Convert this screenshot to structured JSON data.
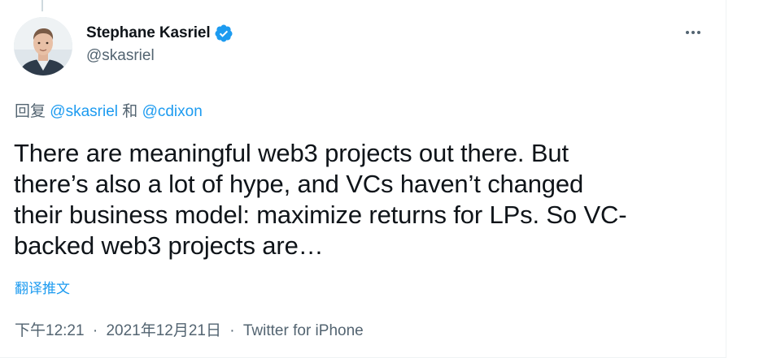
{
  "author": {
    "display_name": "Stephane Kasriel",
    "handle": "@skasriel",
    "verified": true,
    "verified_icon": "verified-badge-icon"
  },
  "reply_context": {
    "prefix": "回复",
    "mentions": [
      "@skasriel",
      "@cdixon"
    ],
    "conjunction": "和"
  },
  "tweet": {
    "lines": [
      "There are meaningful web3 projects out there. But",
      "there’s also a lot of hype, and VCs haven’t changed",
      "their business model: maximize returns for LPs. So VC-",
      "backed web3 projects are…"
    ]
  },
  "translate_label": "翻译推文",
  "meta": {
    "time": "下午12:21",
    "date": "2021年12月21日",
    "source": "Twitter for iPhone",
    "separator": "·"
  },
  "menu_icon": "more-horizontal-icon",
  "colors": {
    "accent": "#1d9bf0",
    "text_primary": "#0f1419",
    "text_secondary": "#536471",
    "border": "#eff3f4"
  }
}
